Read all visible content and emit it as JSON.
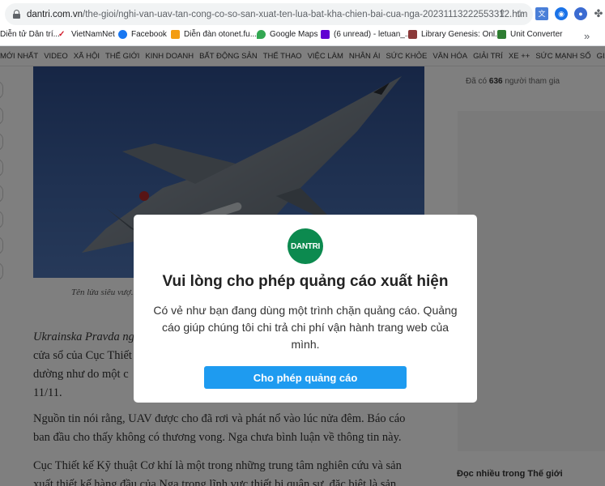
{
  "browser": {
    "url_domain": "dantri.com.vn",
    "url_path": "/the-gioi/nghi-van-uav-tan-cong-co-so-san-xuat-ten-lua-bat-kha-chien-bai-cua-nga-20231113222553312.htm"
  },
  "bookmarks": [
    {
      "label": "Diễn tử Dân trí...",
      "color": "#e7ecf2"
    },
    {
      "label": "VietNamNet",
      "color": "#d11a2a"
    },
    {
      "label": "Facebook",
      "color": "#1877f2"
    },
    {
      "label": "Diễn đàn otonet.fu...",
      "color": "#f39c12"
    },
    {
      "label": "Google Maps",
      "color": "#34a853"
    },
    {
      "label": "(6 unread) - letuan_...",
      "color": "#6001d2"
    },
    {
      "label": "Library Genesis: Onl...",
      "color": "#8b3a3a"
    },
    {
      "label": "Unit Converter",
      "color": "#2e7d32"
    }
  ],
  "nav": [
    "MỚI NHẤT",
    "VIDEO",
    "XÃ HỘI",
    "THẾ GIỚI",
    "KINH DOANH",
    "BẤT ĐỘNG SẢN",
    "THỂ THAO",
    "VIỆC LÀM",
    "NHÂN ÁI",
    "SỨC KHỎE",
    "VĂN HÓA",
    "GIẢI TRÍ",
    "XE ++",
    "SỨC MẠNH SỐ",
    "GIÁO DỤC",
    "AN SINH",
    "PHÁP LUẬT"
  ],
  "article": {
    "caption": "Tên lửa siêu vượ...",
    "para1_line1": "Ukrainska Pravda ng",
    "para1_line2": "cửa sổ của Cục Thiết",
    "para1_line3": "dường như do một c",
    "para1_line4": "11/11.",
    "para2": "Nguồn tin nói rằng, UAV được cho đã rơi và phát nổ vào lúc nửa đêm. Báo cáo ban đầu cho thấy không có thương vong. Nga chưa bình luận về thông tin này.",
    "para3": "Cục Thiết kế Kỹ thuật Cơ khí là một trong những trung tâm nghiên cứu và sản xuất thiết kế hàng đầu của Nga trong lĩnh vực thiết bị quân sự, đặc biệt là sản"
  },
  "sidebar": {
    "participants_prefix": "Đã có",
    "participants_count": "636",
    "participants_suffix": "người tham gia",
    "most_read_title": "Đọc nhiều trong Thế giới"
  },
  "modal": {
    "logo_text": "DANTRI",
    "title": "Vui lòng cho phép quảng cáo xuất hiện",
    "message": "Có vẻ như bạn đang dùng một trình chặn quảng cáo. Quảng cáo giúp chúng tôi chi trả chi phí vận hành trang web của mình.",
    "button_label": "Cho phép quảng cáo",
    "accent_color": "#1e9bf0",
    "logo_color": "#0c8a4f"
  }
}
